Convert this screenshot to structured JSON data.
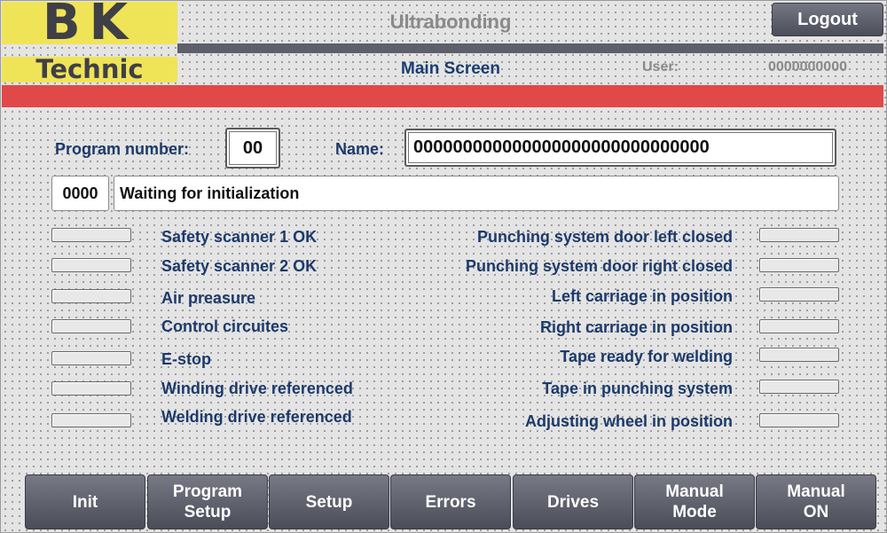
{
  "logo": {
    "line1": "BK",
    "line2": "Technic"
  },
  "header": {
    "app_title": "Ultrabonding",
    "logout_label": "Logout",
    "screen_title": "Main Screen",
    "user_label": "User:",
    "user_value": "0000000000"
  },
  "program": {
    "number_label": "Program number:",
    "number_value": "00",
    "name_label": "Name:",
    "name_value": "000000000000000000000000000000"
  },
  "status": {
    "code": "0000",
    "message": "Waiting for initialization"
  },
  "indicators_left": [
    {
      "label": "Safety scanner 1 OK"
    },
    {
      "label": "Safety scanner 2 OK"
    },
    {
      "label": "Air preasure"
    },
    {
      "label": "Control circuites"
    },
    {
      "label": "E-stop"
    },
    {
      "label": "Winding drive referenced"
    },
    {
      "label": "Welding drive referenced"
    }
  ],
  "indicators_right": [
    {
      "label": "Punching system door left closed"
    },
    {
      "label": "Punching system door right closed"
    },
    {
      "label": "Left carriage in position"
    },
    {
      "label": "Right carriage in position"
    },
    {
      "label": "Tape ready for welding"
    },
    {
      "label": "Tape in punching system"
    },
    {
      "label": "Adjusting wheel in position"
    }
  ],
  "nav_buttons": [
    {
      "label": "Init"
    },
    {
      "label": "Program\nSetup"
    },
    {
      "label": "Setup"
    },
    {
      "label": "Errors"
    },
    {
      "label": "Drives"
    },
    {
      "label": "Manual\nMode"
    },
    {
      "label": "Manual\nON"
    }
  ],
  "colors": {
    "alarm_bar": "#e14848",
    "logo_yellow": "#efe457",
    "label_blue": "#1c3a6b"
  }
}
